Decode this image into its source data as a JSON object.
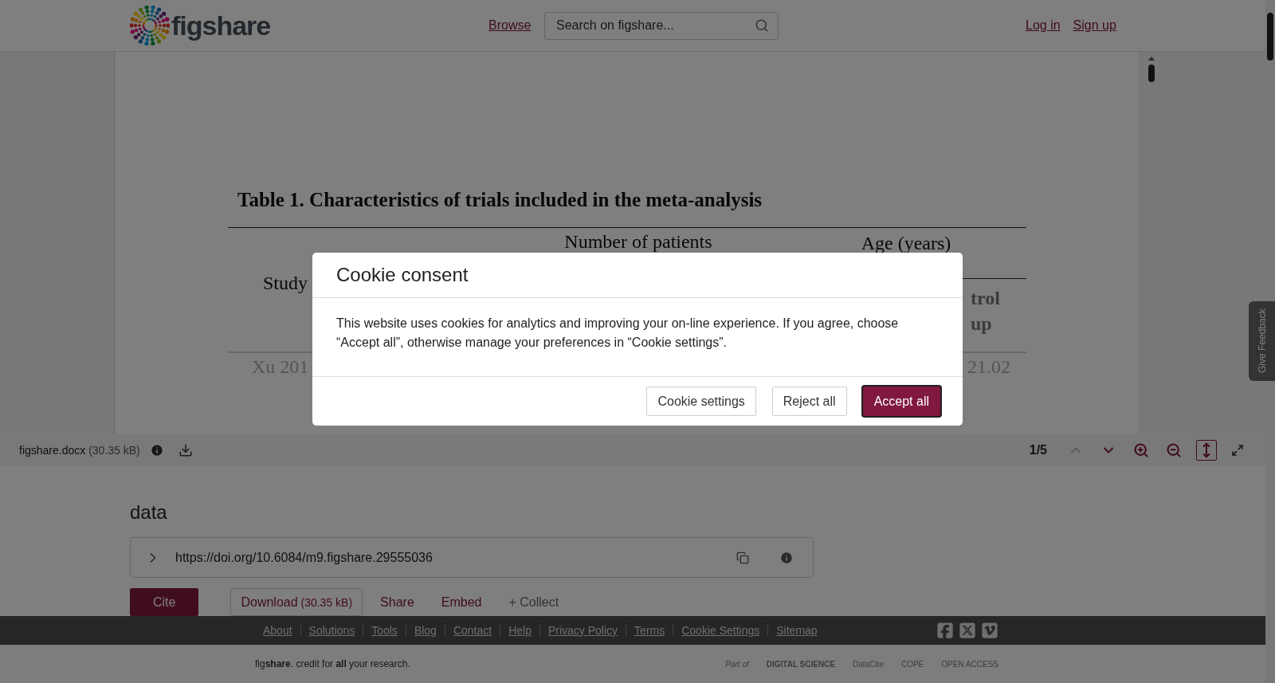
{
  "header": {
    "logo": "figshare",
    "nav_link": "Browse",
    "search": {
      "placeholder": "Search on figshare..."
    },
    "auth_links": [
      "Log in",
      "Sign up"
    ]
  },
  "document": {
    "table_title": "Table 1. Characteristics of trials included in the meta-analysis",
    "study_header": "Study",
    "group_headers": [
      "Number of patients",
      "Age (years)"
    ],
    "subheader_fragments": [
      "trol",
      "up"
    ],
    "row_fragments": [
      "Xu 201",
      "21.02"
    ]
  },
  "viewer_toolbar": {
    "file_name": "figshare.docx",
    "file_size": "(30.35 kB)",
    "page": "1/5",
    "tools": [
      {
        "kind": "prev",
        "disabled": true
      },
      {
        "kind": "next",
        "disabled": false
      },
      {
        "kind": "zoom-in",
        "disabled": false
      },
      {
        "kind": "zoom-out",
        "disabled": false
      },
      {
        "kind": "fit-height",
        "selected": true
      },
      {
        "kind": "fullscreen",
        "selected": false
      }
    ]
  },
  "item": {
    "title": "data",
    "doi": "https://doi.org/10.6084/m9.figshare.29555036",
    "actions": [
      {
        "kind": "primary",
        "label": "Cite"
      },
      {
        "kind": "outline",
        "label": "Download",
        "note": "(30.35 kB)"
      },
      {
        "kind": "link",
        "label": "Share"
      },
      {
        "kind": "link",
        "label": "Embed"
      },
      {
        "kind": "muted",
        "label": "+ Collect"
      }
    ]
  },
  "footer": {
    "links": [
      "About",
      "Solutions",
      "Tools",
      "Blog",
      "Contact",
      "Help",
      "Privacy Policy",
      "Terms",
      "Cookie Settings",
      "Sitemap"
    ],
    "tagline": "fig**share**. credit for **all** your research.",
    "partners": [
      "Part of",
      "DIGITAL SCIENCE",
      "DataCite",
      "COPE",
      "OPEN ACCESS"
    ]
  },
  "feedback_tab": "Give Feedback",
  "cookie_dialog": {
    "title": "Cookie consent",
    "message": "This website uses cookies for analytics and improving your on-line experience. If you agree, choose “Accept all”, otherwise manage your preferences in “Cookie settings”.",
    "buttons": [
      {
        "kind": "secondary",
        "label": "Cookie settings"
      },
      {
        "kind": "secondary",
        "label": "Reject all"
      },
      {
        "kind": "primary",
        "label": "Accept all"
      }
    ]
  }
}
